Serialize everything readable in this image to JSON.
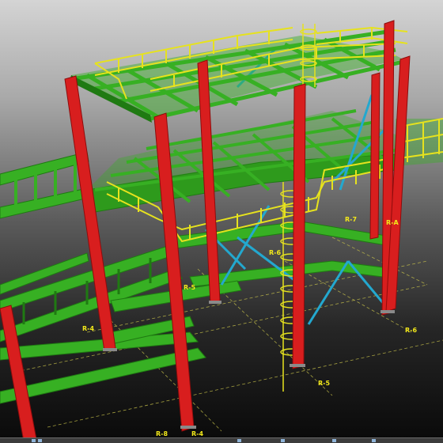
{
  "viewport": {
    "background_top": "#d4d4d4",
    "background_bottom": "#090909"
  },
  "colors": {
    "beam": "#37b023",
    "beam_dark": "#1f7a12",
    "column": "#d81e1e",
    "column_dark": "#8e0c0c",
    "railing": "#e6e21e",
    "brace": "#23a8cf",
    "gridline": "#c8c24a",
    "grid_label": "#f2e81a"
  },
  "grid_labels": {
    "r4_left": "R-4",
    "r5_mid": "R-5",
    "r6_mid": "R-6",
    "r7": "R-7",
    "ra": "R-A",
    "r6_right": "R-6",
    "r5_bottom": "R-5",
    "r8_bottom": "R-8",
    "r4_bottom": "R-4"
  },
  "statusbar": {
    "icons": [
      "toolbar-icon",
      "toolbar-icon",
      "toolbar-icon",
      "toolbar-icon",
      "toolbar-icon",
      "toolbar-icon"
    ]
  }
}
